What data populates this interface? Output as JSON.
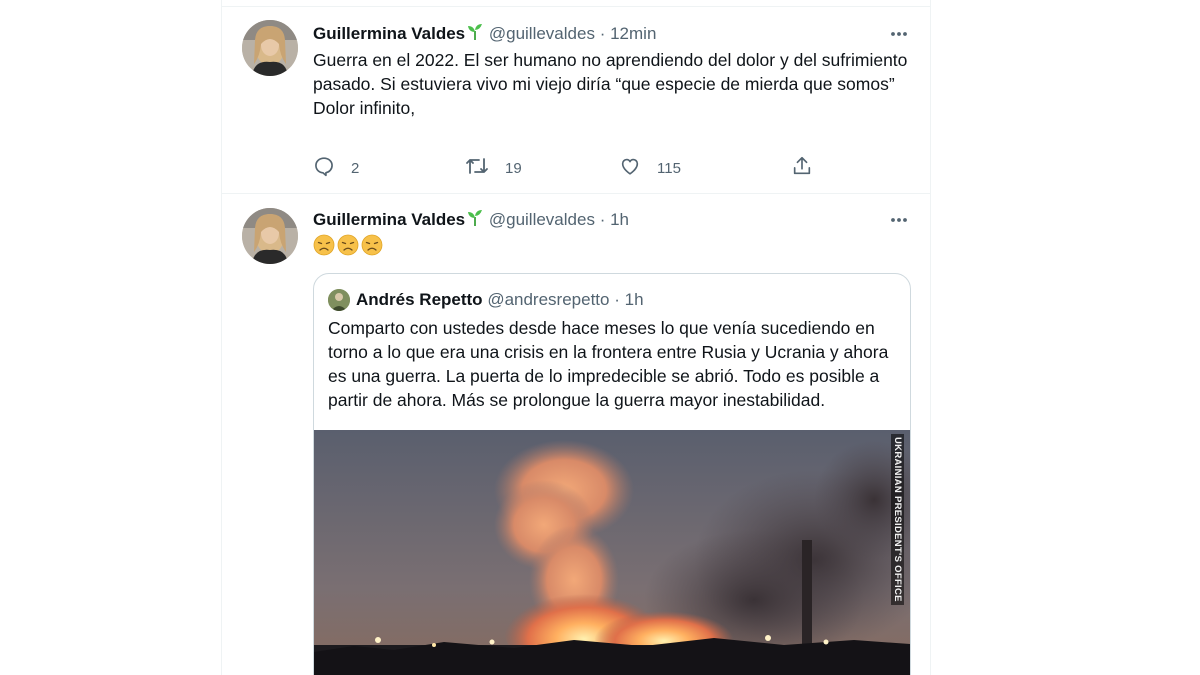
{
  "tweets": [
    {
      "author": "Guillermina Valdes",
      "handle": "@guillevaldes",
      "separator": "·",
      "time": "12min",
      "text": "Guerra en el 2022. El ser humano no aprendiendo del dolor y del sufrimiento pasado. Si estuviera vivo mi viejo diría “que especie de mierda que somos”\nDolor infinito,",
      "replies": "2",
      "retweets": "19",
      "likes": "115"
    },
    {
      "author": "Guillermina Valdes",
      "handle": "@guillevaldes",
      "separator": "·",
      "time": "1h",
      "emojis": [
        "😞",
        "😞",
        "😞"
      ],
      "quote": {
        "author": "Andrés Repetto",
        "handle": "@andresrepetto",
        "separator": "·",
        "time": "1h",
        "text": "Comparto con ustedes desde hace meses lo que venía sucediendo en torno a lo que era una crisis en la frontera entre Rusia y Ucrania y ahora es una guerra. La puerta de lo impredecible se abrió.  Todo es posible a partir de ahora. Más se prolongue la guerra mayor inestabilidad.",
        "media_watermark": "UKRAINIAN PRESIDENT'S OFFICE"
      }
    }
  ],
  "icons": {
    "more": "more-horizontal-icon",
    "reply": "reply-icon",
    "retweet": "retweet-icon",
    "like": "heart-icon",
    "share": "share-icon",
    "verified_emoji": "sprout-icon"
  },
  "colors": {
    "text": "#0f1419",
    "secondary": "#536471",
    "border": "#cfd9de",
    "divider": "#eff3f4"
  }
}
